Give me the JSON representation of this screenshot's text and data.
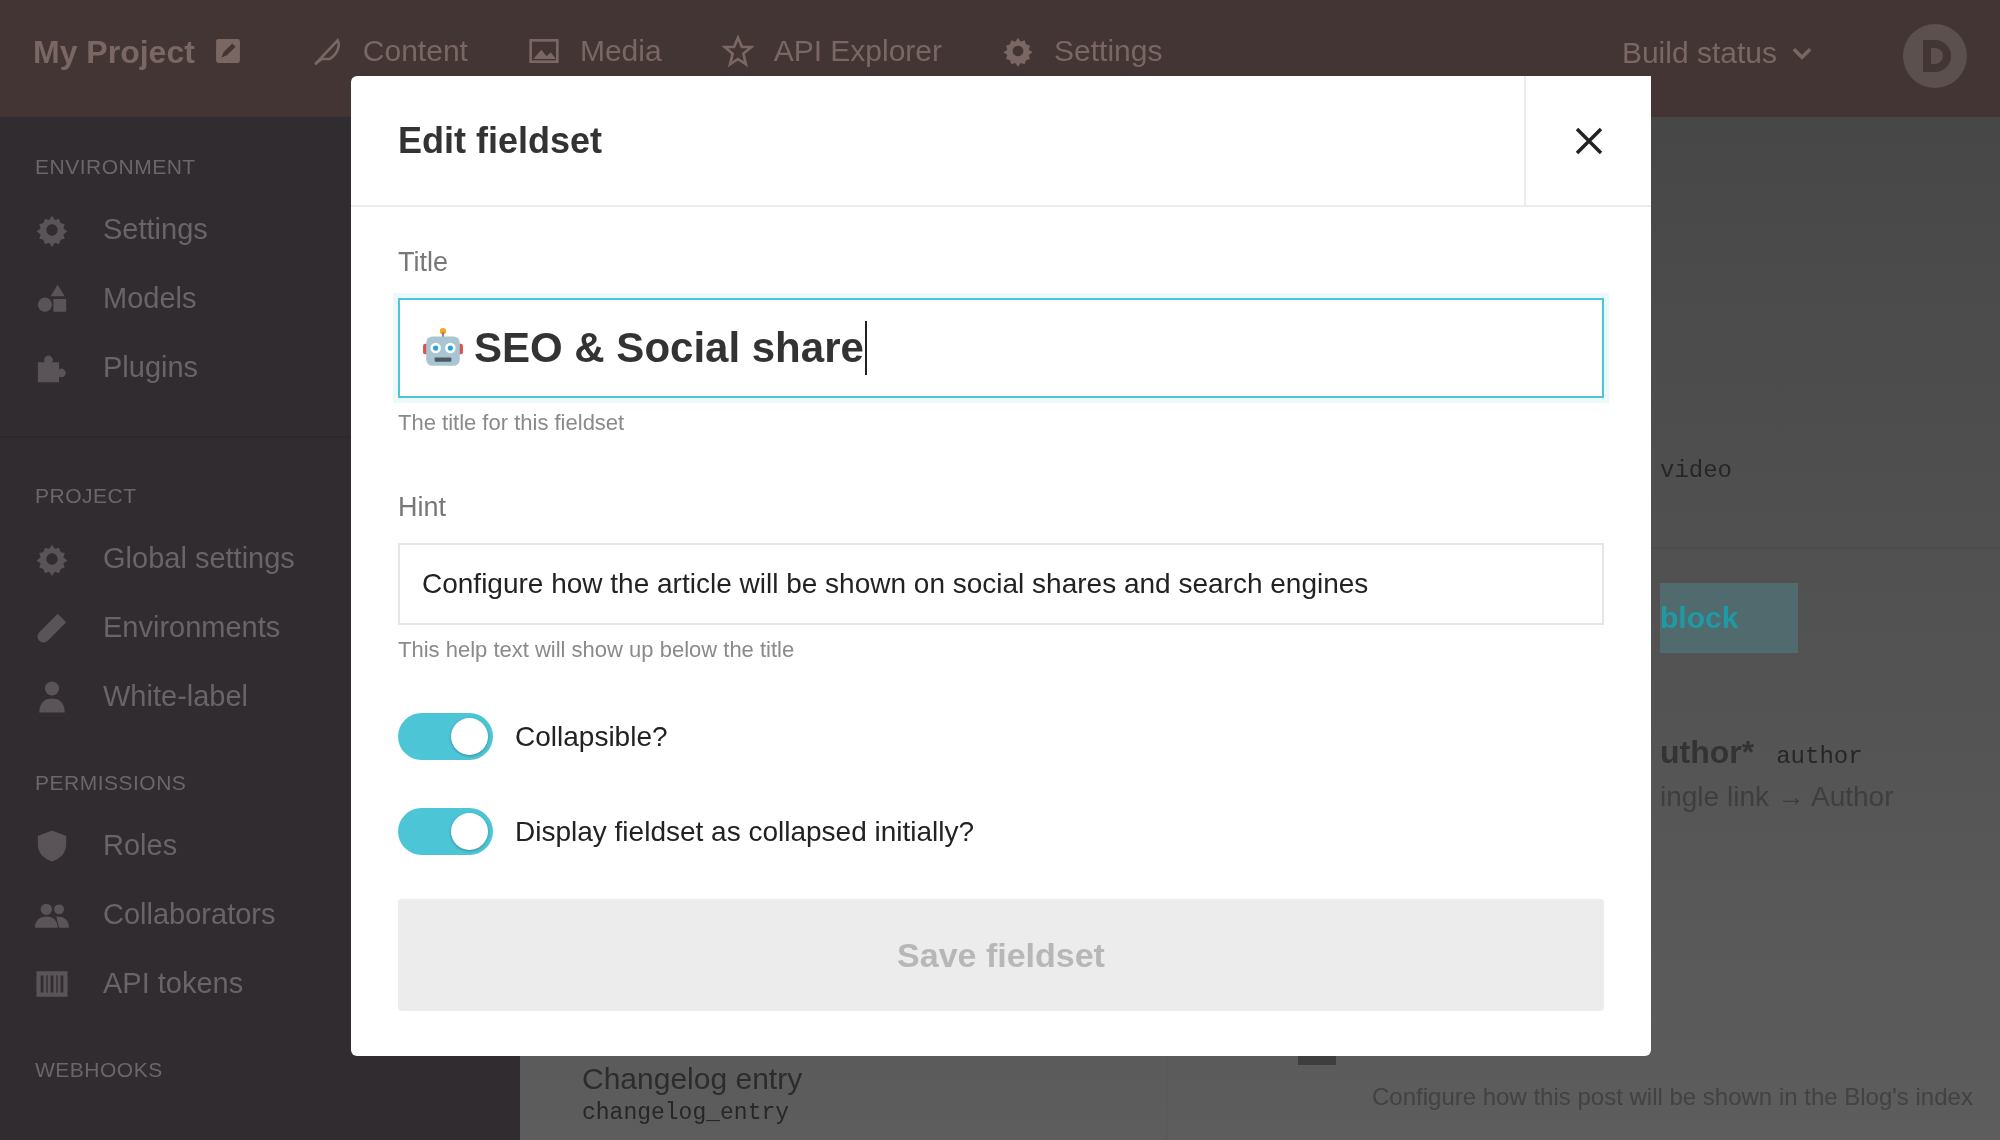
{
  "top_bar": {
    "project": "My Project",
    "nav": [
      {
        "label": "Content"
      },
      {
        "label": "Media"
      },
      {
        "label": "API Explorer"
      },
      {
        "label": "Settings"
      }
    ],
    "build_status": "Build status"
  },
  "sidebar": {
    "sections": [
      {
        "heading": "ENVIRONMENT",
        "items": [
          {
            "label": "Settings"
          },
          {
            "label": "Models"
          },
          {
            "label": "Plugins"
          }
        ]
      },
      {
        "heading": "PROJECT",
        "items": [
          {
            "label": "Global settings"
          },
          {
            "label": "Environments"
          },
          {
            "label": "White-label"
          }
        ]
      },
      {
        "heading": "PERMISSIONS",
        "items": [
          {
            "label": "Roles"
          },
          {
            "label": "Collaborators"
          },
          {
            "label": "API tokens"
          }
        ]
      },
      {
        "heading": "WEBHOOKS"
      }
    ]
  },
  "background": {
    "field_api_key": "video",
    "add_block": "block",
    "author_title": "uthor*",
    "author_key": "author",
    "author_type": "ingle link → Author",
    "model_name": "Changelog entry",
    "model_key": "changelog_entry",
    "fieldset_hint": "Configure how this post will be shown in the Blog's index"
  },
  "modal": {
    "title": "Edit fieldset",
    "fields": [
      {
        "kind": "title",
        "label": "Title",
        "value": "SEO & Social share",
        "help": "The title for this fieldset",
        "focused": true
      },
      {
        "kind": "text",
        "label": "Hint",
        "value": "Configure how the article will be shown on social shares and search engines",
        "help": "This help text will show up below the title",
        "focused": false
      }
    ],
    "toggles": [
      {
        "label": "Collapsible?",
        "on": true
      },
      {
        "label": "Display fieldset as collapsed initially?",
        "on": true
      }
    ],
    "save_button": {
      "label": "Save fieldset",
      "disabled": true
    }
  }
}
